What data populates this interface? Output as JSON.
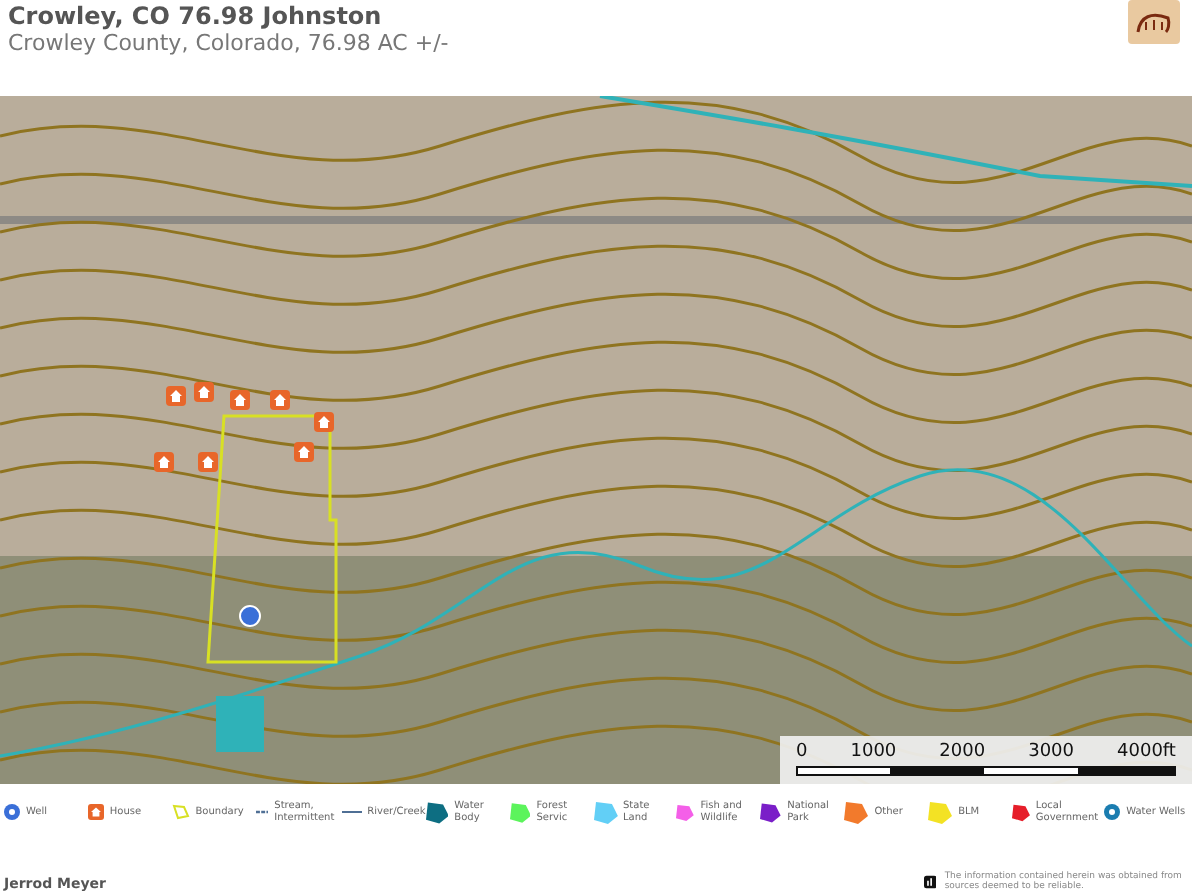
{
  "header": {
    "title": "Crowley, CO 76.98 Johnston",
    "subtitle": "Crowley County, Colorado, 76.98 AC +/-"
  },
  "map": {
    "scale": {
      "labels": [
        "0",
        "1000",
        "2000",
        "3000",
        "4000ft"
      ]
    }
  },
  "legend": [
    {
      "label": "Well",
      "kind": "point",
      "color": "#3a6fd8"
    },
    {
      "label": "House",
      "kind": "house",
      "color": "#e8662a"
    },
    {
      "label": "Boundary",
      "kind": "outline",
      "color": "#d8e024"
    },
    {
      "label": "Stream, Intermittent",
      "kind": "dashed",
      "color": "#4f6f95"
    },
    {
      "label": "River/Creek",
      "kind": "line",
      "color": "#4f6f95"
    },
    {
      "label": "Water Body",
      "kind": "area",
      "color": "#0d6e82"
    },
    {
      "label": "Forest Servic",
      "kind": "area",
      "color": "#5cf45c"
    },
    {
      "label": "State Land",
      "kind": "area",
      "color": "#62cff6"
    },
    {
      "label": "Fish and Wildlife",
      "kind": "area",
      "color": "#f45fe8"
    },
    {
      "label": "National Park",
      "kind": "area",
      "color": "#7a1ec8"
    },
    {
      "label": "Other",
      "kind": "area",
      "color": "#f27a2c"
    },
    {
      "label": "BLM",
      "kind": "area",
      "color": "#f3e224"
    },
    {
      "label": "Local Government",
      "kind": "area",
      "color": "#e61e2a"
    },
    {
      "label": "Water Wells",
      "kind": "point",
      "color": "#1b7db0"
    }
  ],
  "footer": {
    "agent": "Jerrod Meyer",
    "disclaimer": "The information contained herein was obtained from sources deemed to be reliable."
  }
}
